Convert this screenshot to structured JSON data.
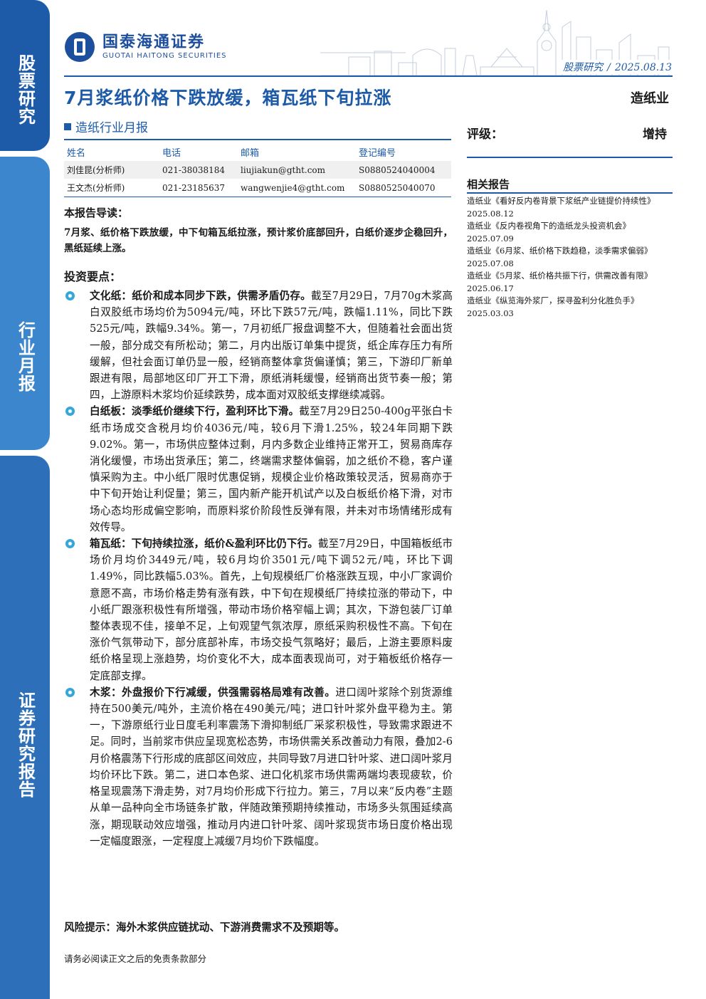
{
  "side_tabs": [
    "股票研究",
    "行业月报",
    "证券研究报告"
  ],
  "logo": {
    "name_cn": "国泰海通证券",
    "name_en": "GUOTAI HAITONG SECURITIES"
  },
  "header": {
    "section": "股票研究",
    "separator": "/",
    "date": "2025.08.13"
  },
  "title": "7月浆纸价格下跌放缓，箱瓦纸下旬拉涨",
  "industry": "造纸业",
  "subtitle": "造纸行业月报",
  "analysts": {
    "headers": [
      "姓名",
      "电话",
      "邮箱",
      "登记编号"
    ],
    "rows": [
      [
        "刘佳昆(分析师)",
        "021-38038184",
        "liujiakun@gtht.com",
        "S0880524040004"
      ],
      [
        "王文杰(分析师)",
        "021-23185637",
        "wangwenjie4@gtht.com",
        "S0880525040070"
      ]
    ]
  },
  "rating": {
    "label": "评级：",
    "value": "增持"
  },
  "related": {
    "title": "相关报告",
    "items": [
      "造纸业《看好反内卷背景下浆纸产业链提价持续性》2025.08.12",
      "造纸业《反内卷视角下的造纸龙头投资机会》2025.07.09",
      "造纸业《6月浆、纸价格下跌趋稳，淡季需求偏弱》2025.07.08",
      "造纸业《5月浆、纸价格共振下行，供需改善有限》2025.06.17",
      "造纸业《纵览海外浆厂，探寻盈利分化胜负手》2025.03.03"
    ]
  },
  "guide": {
    "title": "本报告导读：",
    "text": "7月浆、纸价格下跌放缓，中下旬箱瓦纸拉涨，预计浆价底部回升，白纸价逐步企稳回升，黑纸延续上涨。"
  },
  "points": {
    "title": "投资要点：",
    "items": [
      {
        "lead": "文化纸：纸价和成本同步下跌，供需矛盾仍存。",
        "text": "截至7月29日，7月70g木浆高白双胶纸市场均价为5094元/吨，环比下跌57元/吨，跌幅1.11%，同比下跌525元/吨，跌幅9.34%。第一，7月初纸厂报盘调整不大，但随着社会面出货一般，部分成交有所松动；第二，月内出版订单集中提货，纸企库存压力有所缓解，但社会面订单仍显一般，经销商整体拿货偏谨慎；第三，下游印厂新单跟进有限，局部地区印厂开工下滑，原纸消耗缓慢，经销商出货节奏一般；第四，上游原料木浆均价延续跌势，成本面对双胶纸支撑继续减弱。"
      },
      {
        "lead": "白纸板：淡季纸价继续下行，盈利环比下滑。",
        "text": "截至7月29日250-400g平张白卡纸市场成交含税月均价4036元/吨，较6月下滑1.25%，较24年同期下跌9.02%。第一，市场供应整体过剩，月内多数企业维持正常开工，贸易商库存消化缓慢，市场出货承压；第二，终端需求整体偏弱，加之纸价不稳，客户谨慎采购为主。中小纸厂限时优惠促销，规模企业价格政策较灵活，贸易商亦于中下旬开始让利促量；第三，国内新产能开机试产以及白板纸价格下滑，对市场心态均形成偏空影响，而原料浆价阶段性反弹有限，并未对市场情绪形成有效传导。"
      },
      {
        "lead": "箱瓦纸：下旬持续拉涨，纸价&盈利环比仍下行。",
        "text": "截至7月29日，中国箱板纸市场价月均价3449元/吨，较6月均价3501元/吨下调52元/吨，环比下调1.49%，同比跌幅5.03%。首先，上旬规模纸厂价格涨跌互现，中小厂家调价意愿不高，市场价格走势有涨有跌，中下旬在规模纸厂持续拉涨的带动下，中小纸厂跟涨积极性有所增强，带动市场价格窄幅上调；其次，下游包装厂订单整体表现不佳，接单不足，上旬观望气氛浓厚，原纸采购积极性不高。下旬在涨价气氛带动下，部分底部补库，市场交投气氛略好；最后，上游主要原料废纸价格呈现上涨趋势，均价变化不大，成本面表现尚可，对于箱板纸价格存一定底部支撑。"
      },
      {
        "lead": "木浆：外盘报价下行减缓，供强需弱格局难有改善。",
        "text": "进口阔叶浆除个别货源维持在500美元/吨外，主流价格在490美元/吨；进口针叶浆外盘平稳为主。第一，下游原纸行业日度毛利率震荡下滑抑制纸厂采浆积极性，导致需求跟进不足。同时，当前浆市供应呈现宽松态势，市场供需关系改善动力有限，叠加2-6月价格震荡下行形成的底部区间效应，共同导致7月进口针叶浆、进口阔叶浆月均价环比下跌。第二，进口本色浆、进口化机浆市场供需两端均表现疲软，价格呈现震荡下滑走势，对7月均价形成下行拉力。第三，7月以来“反内卷”主题从单一品种向全市场链条扩散，伴随政策预期持续推动，市场多头氛围延续高涨，期现联动效应增强，推动月内进口针叶浆、阔叶浆现货市场日度价格出现一定幅度跟涨，一定程度上减缓7月均价下跌幅度。"
      }
    ]
  },
  "risk": "风险提示：海外木浆供应链扰动、下游消费需求不及预期等。",
  "disclaimer": "请务必阅读正文之后的免责条款部分",
  "colors": {
    "brand_blue": "#1d5ba8",
    "tab_light": "#3b86cc",
    "bullet": "#35a6d9"
  }
}
